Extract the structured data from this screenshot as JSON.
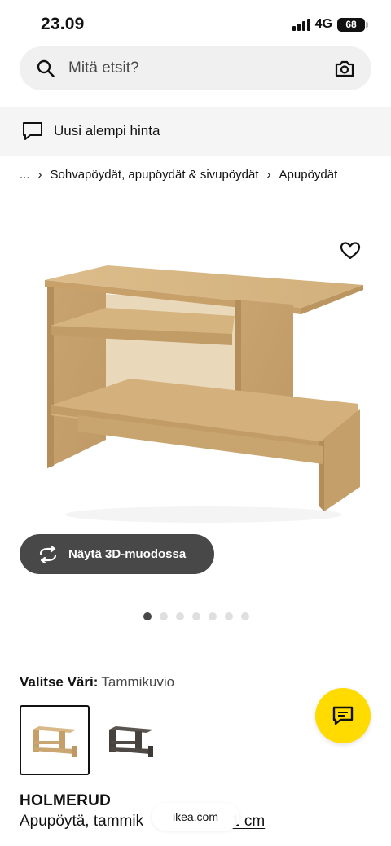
{
  "status_bar": {
    "time": "23.09",
    "network": "4G",
    "battery": "68"
  },
  "search": {
    "placeholder": "Mitä etsit?"
  },
  "promo": {
    "label": "Uusi alempi hinta"
  },
  "breadcrumb": {
    "items": [
      "...",
      "Sohvapöydät, apupöydät & sivupöydät",
      "Apupöydät"
    ],
    "separator": "›"
  },
  "view_3d": {
    "label": "Näytä 3D-muodossa"
  },
  "carousel": {
    "count": 7,
    "active_index": 0
  },
  "color_selector": {
    "label": "Valitse Väri:",
    "selected": "Tammikuvio",
    "options": [
      {
        "icon": "oak-table-thumbnail",
        "color": "#c9a26b",
        "selected": true
      },
      {
        "icon": "dark-table-thumbnail",
        "color": "#4a4541",
        "selected": false
      }
    ]
  },
  "product": {
    "name": "HOLMERUD",
    "description": "Apupöytä, tammik",
    "description_end": "1 cm"
  },
  "browser": {
    "domain": "ikea.com"
  },
  "icons": {
    "search": "search-icon",
    "camera": "camera-icon",
    "promo": "chat-bubble-icon",
    "favorite": "heart-icon",
    "rotate": "rotate-3d-icon",
    "chat": "chat-icon"
  },
  "colors": {
    "accent_yellow": "#ffdb00",
    "dark_button": "#484848"
  }
}
